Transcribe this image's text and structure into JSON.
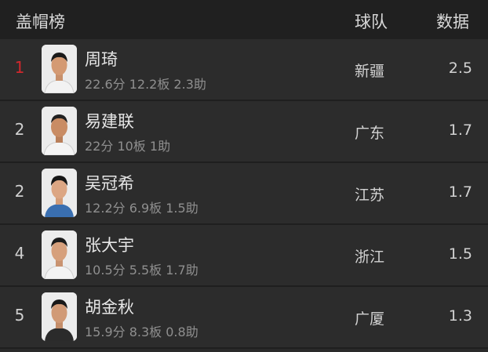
{
  "header": {
    "title": "盖帽榜",
    "team_col": "球队",
    "data_col": "数据"
  },
  "rows": [
    {
      "rank": "1",
      "name": "周琦",
      "stats": "22.6分 12.2板 2.3助",
      "team": "新疆",
      "value": "2.5",
      "rank_color": "#d2282d"
    },
    {
      "rank": "2",
      "name": "易建联",
      "stats": "22分 10板 1助",
      "team": "广东",
      "value": "1.7"
    },
    {
      "rank": "2",
      "name": "吴冠希",
      "stats": "12.2分 6.9板 1.5助",
      "team": "江苏",
      "value": "1.7"
    },
    {
      "rank": "4",
      "name": "张大宇",
      "stats": "10.5分 5.5板 1.7助",
      "team": "浙江",
      "value": "1.5"
    },
    {
      "rank": "5",
      "name": "胡金秋",
      "stats": "15.9分 8.3板 0.8助",
      "team": "广厦",
      "value": "1.3"
    }
  ],
  "icons": {
    "avatar": "player-photo"
  },
  "colors": {
    "background": "#2a2a2a",
    "header_bg": "#202020",
    "rank_highlight": "#d2282d"
  }
}
